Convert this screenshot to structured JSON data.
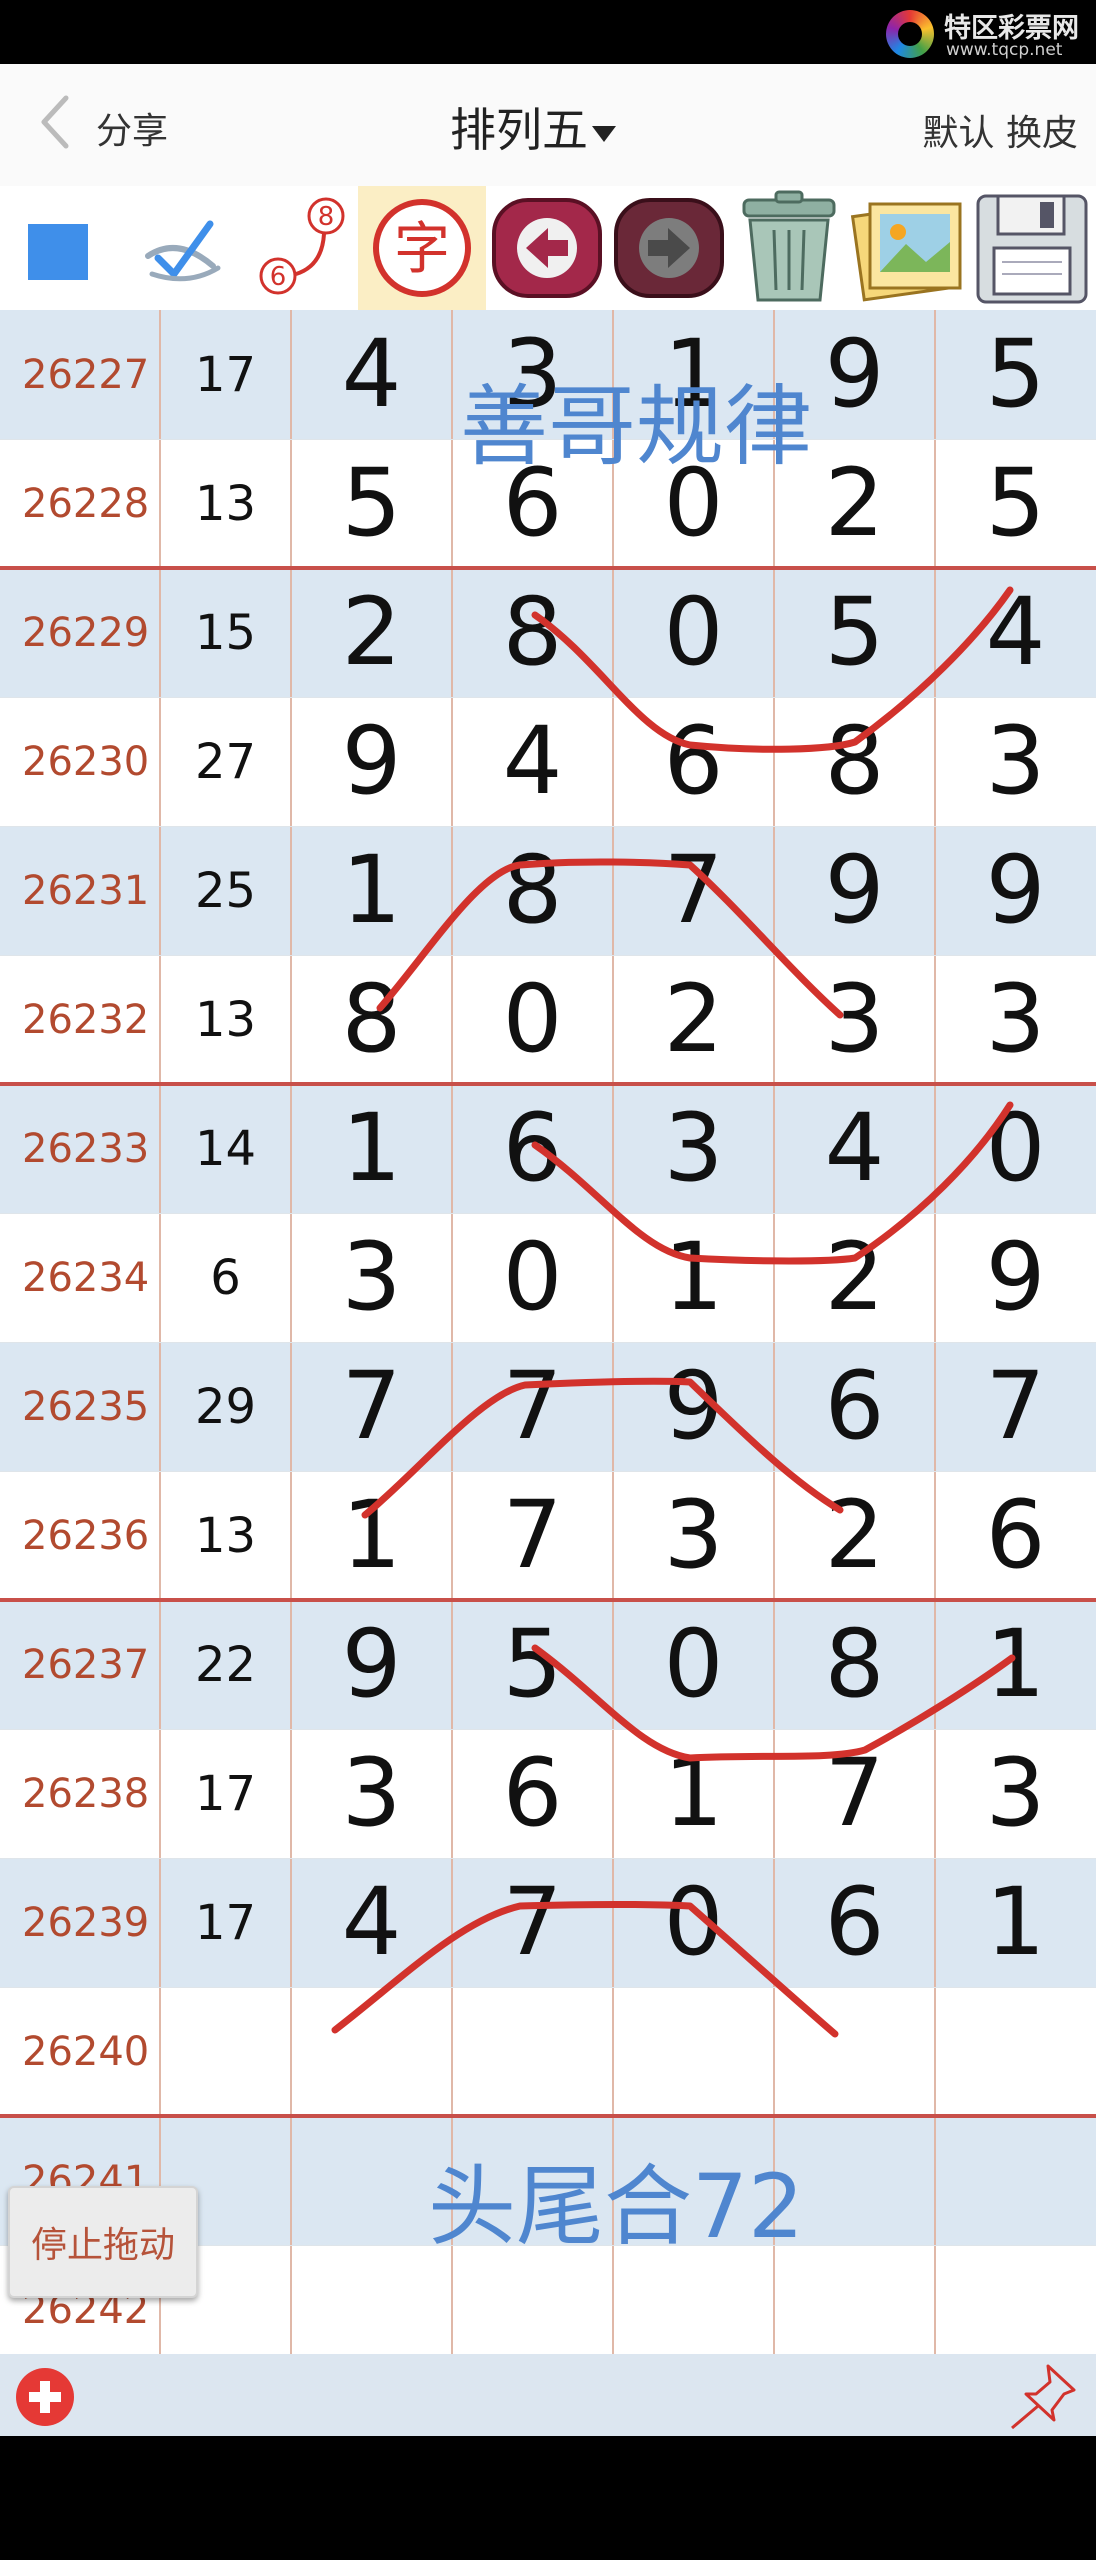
{
  "status_bar": {
    "logo_name": "特区彩票网",
    "logo_url": "www.tqcp.net"
  },
  "nav": {
    "back_label": "分享",
    "title": "排列五",
    "skin_label": "默认 换皮"
  },
  "toolbar": {
    "tools": [
      "color-square",
      "pen-check",
      "connect-numbers",
      "text-tool",
      "undo",
      "redo",
      "trash",
      "image",
      "save"
    ],
    "text_tool_glyph": "字",
    "connect_label_a": "8",
    "connect_label_b": "6",
    "accent_blue": "#3f8fea",
    "accent_red": "#c8504a"
  },
  "table": {
    "rows": [
      {
        "issue": "26227",
        "sum": "17",
        "digits": [
          "4",
          "3",
          "1",
          "9",
          "5"
        ]
      },
      {
        "issue": "26228",
        "sum": "13",
        "digits": [
          "5",
          "6",
          "0",
          "2",
          "5"
        ]
      },
      {
        "issue": "26229",
        "sum": "15",
        "digits": [
          "2",
          "8",
          "0",
          "5",
          "4"
        ]
      },
      {
        "issue": "26230",
        "sum": "27",
        "digits": [
          "9",
          "4",
          "6",
          "8",
          "3"
        ]
      },
      {
        "issue": "26231",
        "sum": "25",
        "digits": [
          "1",
          "8",
          "7",
          "9",
          "9"
        ]
      },
      {
        "issue": "26232",
        "sum": "13",
        "digits": [
          "8",
          "0",
          "2",
          "3",
          "3"
        ]
      },
      {
        "issue": "26233",
        "sum": "14",
        "digits": [
          "1",
          "6",
          "3",
          "4",
          "0"
        ]
      },
      {
        "issue": "26234",
        "sum": "6",
        "digits": [
          "3",
          "0",
          "1",
          "2",
          "9"
        ]
      },
      {
        "issue": "26235",
        "sum": "29",
        "digits": [
          "7",
          "7",
          "9",
          "6",
          "7"
        ]
      },
      {
        "issue": "26236",
        "sum": "13",
        "digits": [
          "1",
          "7",
          "3",
          "2",
          "6"
        ]
      },
      {
        "issue": "26237",
        "sum": "22",
        "digits": [
          "9",
          "5",
          "0",
          "8",
          "1"
        ]
      },
      {
        "issue": "26238",
        "sum": "17",
        "digits": [
          "3",
          "6",
          "1",
          "7",
          "3"
        ]
      },
      {
        "issue": "26239",
        "sum": "17",
        "digits": [
          "4",
          "7",
          "0",
          "6",
          "1"
        ]
      },
      {
        "issue": "26240",
        "sum": "",
        "digits": [
          "",
          "",
          "",
          "",
          ""
        ]
      },
      {
        "issue": "26241",
        "sum": "",
        "digits": [
          "",
          "",
          "",
          "",
          ""
        ]
      },
      {
        "issue": "26242",
        "sum": "",
        "digits": [
          "",
          "",
          "",
          "",
          ""
        ]
      }
    ]
  },
  "annotations": {
    "top_text": "善哥规律",
    "bottom_text": "头尾合72",
    "line_color": "#d2322c"
  },
  "floating": {
    "stop_drag_label": "停止拖动"
  },
  "bottom_bar": {
    "add_icon": "add-circle-icon",
    "pin_icon": "pushpin-icon"
  }
}
